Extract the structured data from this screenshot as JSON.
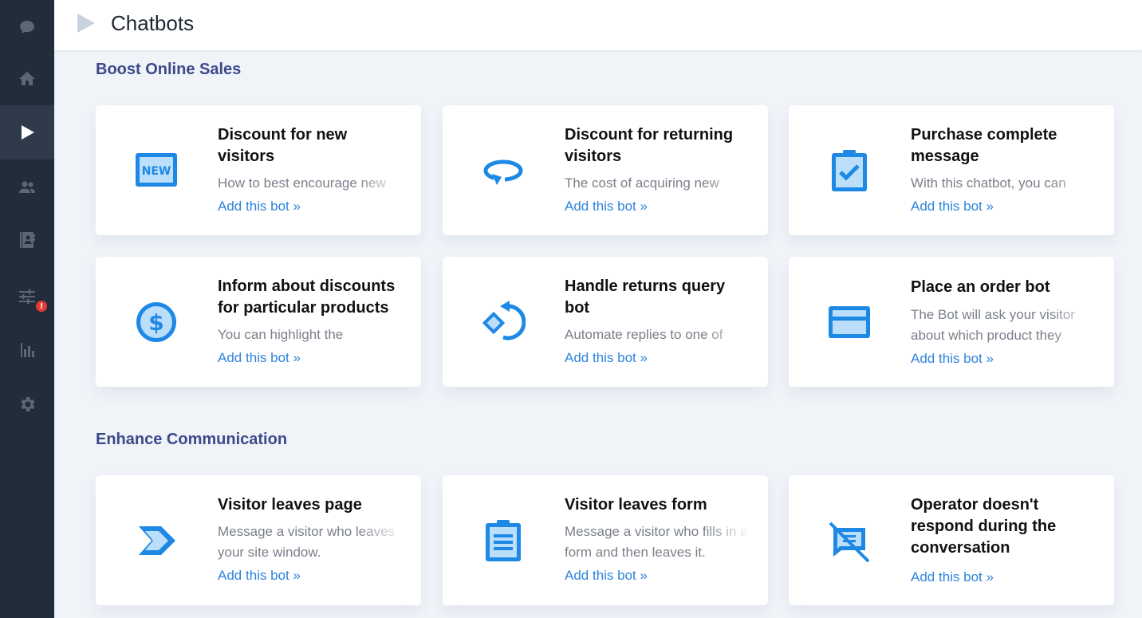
{
  "colors": {
    "sidebar_bg": "#222c3a",
    "sidebar_active": "#2f3a4a",
    "accent_blue": "#2196f3",
    "link": "#2f84dd",
    "section_title": "#3d4a8a",
    "badge": "#e53935"
  },
  "sidebar": {
    "items": [
      {
        "icon": "chat-bubble-icon",
        "active": false
      },
      {
        "icon": "home-icon",
        "active": false
      },
      {
        "icon": "play-icon",
        "active": true
      },
      {
        "icon": "users-icon",
        "active": false
      },
      {
        "icon": "contacts-book-icon",
        "active": false
      },
      {
        "icon": "sliders-icon",
        "active": false,
        "badge": "!"
      },
      {
        "icon": "bar-chart-icon",
        "active": false
      },
      {
        "icon": "gear-icon",
        "active": false
      }
    ]
  },
  "header": {
    "icon": "play-triangle-icon",
    "title": "Chatbots"
  },
  "sections": [
    {
      "title": "Boost Online Sales",
      "cards": [
        {
          "icon": "new-tag-icon",
          "title": "Discount for new visitors",
          "desc": "How to best encourage new",
          "link": "Add this bot »"
        },
        {
          "icon": "returning-arrow-icon",
          "title": "Discount for returning visitors",
          "desc": "The cost of acquiring new",
          "link": "Add this bot »"
        },
        {
          "icon": "clipboard-check-icon",
          "title": "Purchase complete message",
          "desc": "With this chatbot, you can",
          "link": "Add this bot »"
        },
        {
          "icon": "dollar-coin-icon",
          "title": "Inform about discounts for particular products",
          "desc": "You can highlight the",
          "link": "Add this bot »"
        },
        {
          "icon": "return-rotate-icon",
          "title": "Handle returns query bot",
          "desc": "Automate replies to one of",
          "link": "Add this bot »"
        },
        {
          "icon": "credit-card-icon",
          "title": "Place an order bot",
          "desc": "The Bot will ask your visitor about which product they",
          "link": "Add this bot »"
        }
      ]
    },
    {
      "title": "Enhance Communication",
      "cards": [
        {
          "icon": "chevron-arrow-icon",
          "title": "Visitor leaves page",
          "desc": "Message a visitor who leaves your site window.",
          "link": "Add this bot »"
        },
        {
          "icon": "clipboard-form-icon",
          "title": "Visitor leaves form",
          "desc": "Message a visitor who fills in a form and then leaves it.",
          "link": "Add this bot »"
        },
        {
          "icon": "message-off-icon",
          "title": "Operator doesn't respond during the conversation",
          "desc": "",
          "link": "Add this bot »"
        }
      ]
    }
  ]
}
